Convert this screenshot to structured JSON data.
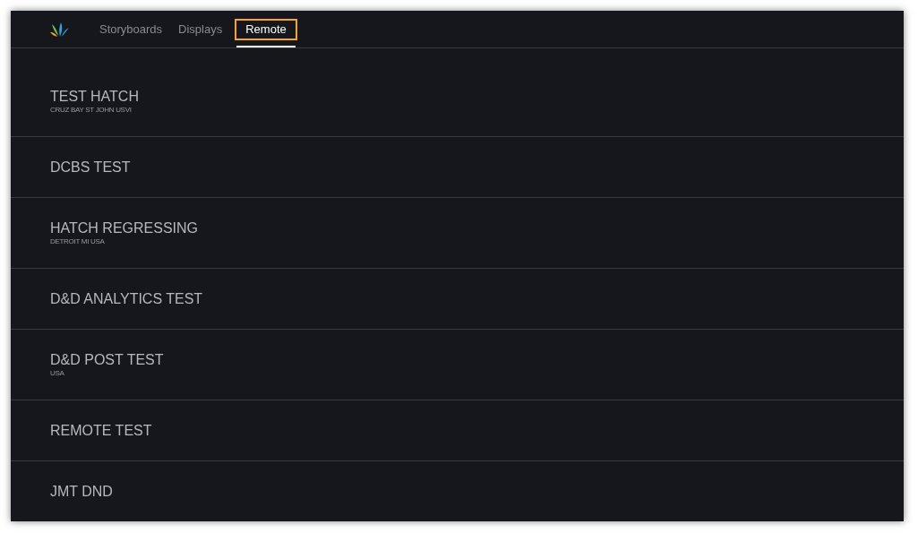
{
  "tabs": [
    {
      "label": "Storyboards",
      "selected": false
    },
    {
      "label": "Displays",
      "selected": false
    },
    {
      "label": "Remote",
      "selected": true
    }
  ],
  "displays": [
    {
      "name": "TEST HATCH",
      "location": "CRUZ BAY ST JOHN USVI"
    },
    {
      "name": "DCBS TEST"
    },
    {
      "name": "HATCH REGRESSING",
      "location": "DETROIT MI USA"
    },
    {
      "name": "D&D ANALYTICS TEST"
    },
    {
      "name": "D&D POST TEST",
      "location": "USA"
    },
    {
      "name": "REMOTE TEST"
    },
    {
      "name": "JMT DND"
    }
  ]
}
